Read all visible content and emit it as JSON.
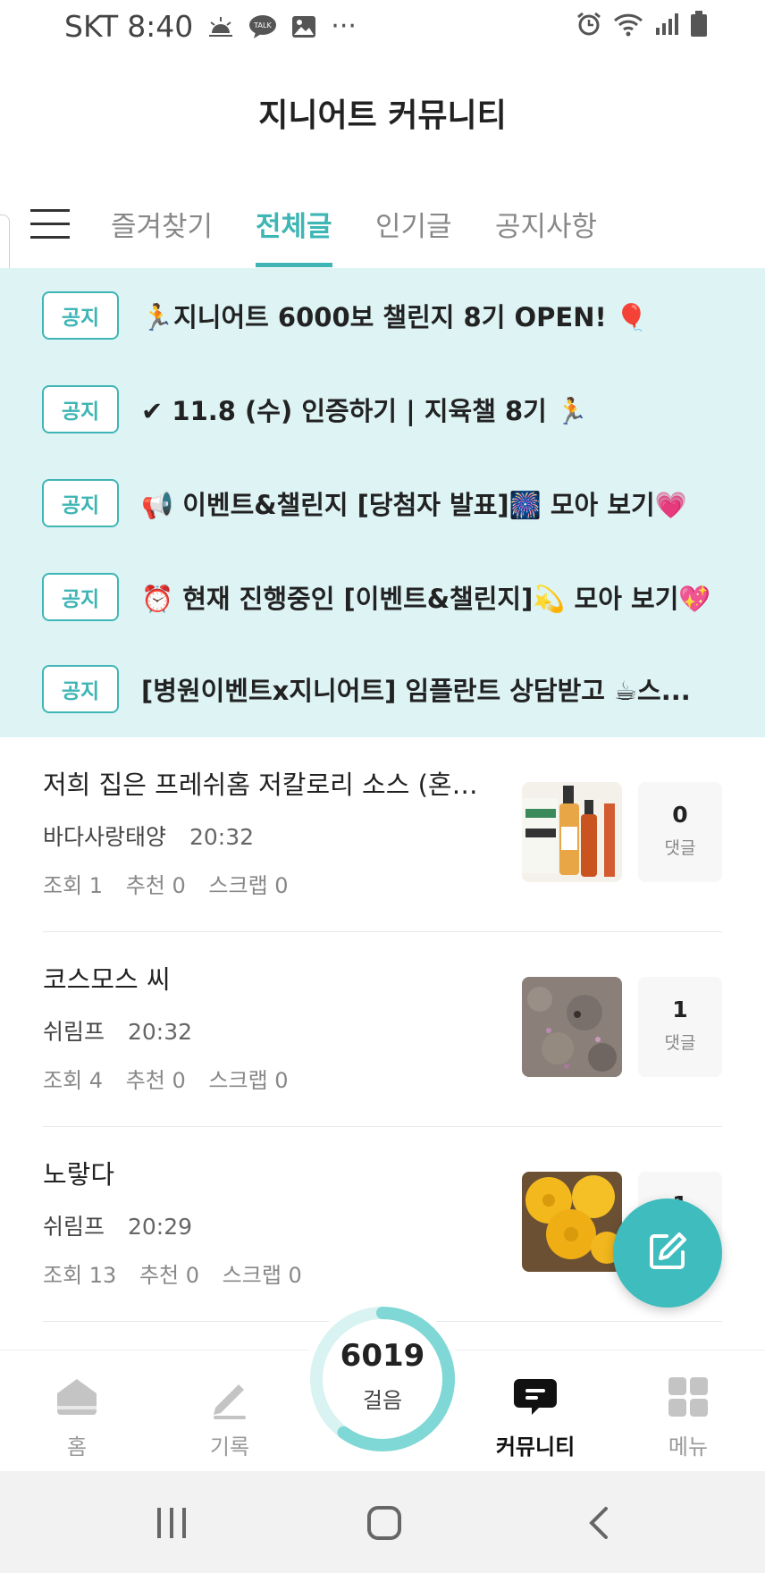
{
  "status_bar": {
    "carrier": "SKT",
    "time": "8:40",
    "dots": "···"
  },
  "app": {
    "title": "지니어트 커뮤니티"
  },
  "tabs": [
    {
      "label": "즐겨찾기",
      "active": false
    },
    {
      "label": "전체글",
      "active": true
    },
    {
      "label": "인기글",
      "active": false
    },
    {
      "label": "공지사항",
      "active": false
    }
  ],
  "notices": [
    {
      "badge": "공지",
      "text": "🏃지니어트 6000보 챌린지 8기 OPEN! 🎈"
    },
    {
      "badge": "공지",
      "text": "✔ 11.8 (수) 인증하기 | 지육챌 8기 🏃"
    },
    {
      "badge": "공지",
      "text": "📢 이벤트&챌린지 [당첨자 발표]🎆 모아 보기💗"
    },
    {
      "badge": "공지",
      "text": "⏰ 현재 진행중인 [이벤트&챌린지]💫 모아 보기💖"
    },
    {
      "badge": "공지",
      "text": "[병원이벤트x지니어트] 임플란트 상담받고 ☕스..."
    }
  ],
  "posts": [
    {
      "title": "저희 집은 프레쉬홈 저칼로리 소스 (혼합) ...",
      "author": "바다사랑태양",
      "time": "20:32",
      "views": "조회 1",
      "likes": "추천 0",
      "scraps": "스크랩 0",
      "comments": "0",
      "comment_label": "댓글"
    },
    {
      "title": "코스모스 씨",
      "author": "쉬림프",
      "time": "20:32",
      "views": "조회 4",
      "likes": "추천 0",
      "scraps": "스크랩 0",
      "comments": "1",
      "comment_label": "댓글"
    },
    {
      "title": "노랗다",
      "author": "쉬림프",
      "time": "20:29",
      "views": "조회 13",
      "likes": "추천 0",
      "scraps": "스크랩 0",
      "comments": "1",
      "comment_label": "댓글"
    }
  ],
  "bottom_nav": {
    "home": "홈",
    "record": "기록",
    "steps_count": "6019",
    "steps_label": "걸음",
    "steps_progress": 0.6,
    "community": "커뮤니티",
    "menu": "메뉴"
  },
  "colors": {
    "accent": "#3fb5b5",
    "notice_bg": "#ddf3f4"
  },
  "icons": [
    "sunny-icon",
    "talk-icon",
    "image-icon",
    "alarm-icon",
    "wifi-icon",
    "signal-icon",
    "battery-icon",
    "hamburger-menu-icon",
    "edit-icon",
    "home-icon",
    "pencil-icon",
    "chat-icon",
    "grid-icon"
  ]
}
